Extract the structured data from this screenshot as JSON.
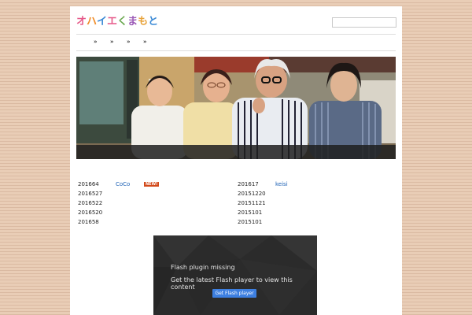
{
  "site": {
    "logo_text": "オハイエくまもと",
    "logo_colors": [
      "#e65a8a",
      "#f08c28",
      "#3d8bd6",
      "#e65a8a",
      "#6aa84f",
      "#9b59b6",
      "#e8a33a",
      "#3d8bd6"
    ]
  },
  "search": {
    "value": "",
    "placeholder": ""
  },
  "nav": {
    "items": [
      "»",
      "»",
      "»",
      "»"
    ]
  },
  "hero": {
    "caption": ""
  },
  "list_left": [
    {
      "date": "201664",
      "name": "CoCo",
      "badge": "NEW!"
    },
    {
      "date": "2016527",
      "name": "",
      "badge": ""
    },
    {
      "date": "2016522",
      "name": "",
      "badge": ""
    },
    {
      "date": "2016520",
      "name": "",
      "badge": ""
    },
    {
      "date": "201658",
      "name": "",
      "badge": ""
    }
  ],
  "list_right": [
    {
      "date": "201617",
      "name": "keisi"
    },
    {
      "date": "20151220",
      "name": ""
    },
    {
      "date": "20151121",
      "name": ""
    },
    {
      "date": "2015101",
      "name": ""
    },
    {
      "date": "2015101",
      "name": ""
    }
  ],
  "flash": {
    "title": "Flash plugin missing",
    "subtitle": "Get the latest Flash player to view this content",
    "button_label": "Get Flash player"
  }
}
